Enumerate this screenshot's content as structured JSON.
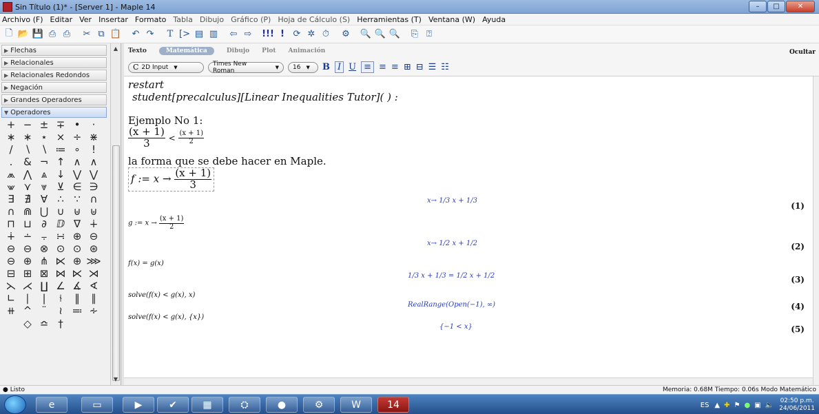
{
  "window": {
    "title": "Sin Título (1)* - [Server 1] - Maple 14",
    "minimize": "–",
    "maximize": "□",
    "close": "✕"
  },
  "menu": [
    "Archivo (F)",
    "Editar",
    "Ver",
    "Insertar",
    "Formato",
    "Tabla",
    "Dibujo",
    "Gráfico (P)",
    "Hoja de Cálculo (S)",
    "Herramientas (T)",
    "Ventana (W)",
    "Ayuda"
  ],
  "palette": {
    "sections": [
      "Flechas",
      "Relacionales",
      "Relacionales Redondos",
      "Negación",
      "Grandes Operadores"
    ],
    "open_section": "Operadores",
    "symbols": [
      "+",
      "−",
      "±",
      "∓",
      "•",
      "·",
      "∗",
      "∗",
      "⋆",
      "×",
      "÷",
      "⋇",
      "/",
      "∖",
      "∖",
      "≔",
      "∘",
      "!",
      ".",
      "&",
      "¬",
      "↑",
      "∧",
      "∧",
      "⩕",
      "⋀",
      "⩓",
      "↓",
      "⋁",
      "⋁",
      "⩖",
      "⋎",
      "⩔",
      "⊻",
      "∈",
      "∋",
      "∃",
      "∄",
      "∀",
      "∴",
      "∵",
      "∩",
      "∩",
      "⋒",
      "⋃",
      "∪",
      "⊎",
      "⊎",
      "⊓",
      "⊔",
      "∂",
      "ⅅ",
      "∇",
      "∔",
      "∔",
      "∸",
      "⨪",
      "∺",
      "⊕",
      "⊖",
      "⊖",
      "⊖",
      "⊗",
      "⊙",
      "⊙",
      "⊛",
      "⊖",
      "⊕",
      "⋔",
      "⋉",
      "⊕",
      "⋙",
      "⊟",
      "⊞",
      "⊠",
      "⋈",
      "⋉",
      "⋊",
      "⋋",
      "⋌",
      "∐",
      "∠",
      "∡",
      "∢",
      "∟",
      "∣",
      "|",
      "⫮",
      "‖",
      "∥",
      "⧺",
      "^",
      "¨",
      "≀",
      "≕",
      "∻"
    ],
    "last_row": [
      "◇",
      "≏",
      "†"
    ]
  },
  "context": {
    "tabs": [
      "Texto",
      "Matemática",
      "Dibujo",
      "Plot",
      "Animación"
    ],
    "active_tab": "Matemática",
    "hide": "Ocultar",
    "input_mode": "2D Input",
    "font": "Times New Roman",
    "size": "16"
  },
  "doc": {
    "cmd1": "restart",
    "cmd2": "student[precalculus][Linear Inequalities Tutor]( ) :",
    "heading": "Ejemplo No 1:",
    "ineq_num_left": "(x + 1)",
    "ineq_den_left": "3",
    "ineq_op": "<",
    "ineq_num_right": "(x + 1)",
    "ineq_den_right": "2",
    "note": "la forma que se debe hacer en Maple.",
    "f_prefix": "f := x →",
    "f_num": "(x + 1)",
    "f_den": "3",
    "g_prefix": "g := x →",
    "g_num": "(x + 1)",
    "g_den": "2",
    "cmd_eq": "f(x) = g(x)",
    "cmd_solve1": "solve(f(x) < g(x), x)",
    "cmd_solve2": "solve(f(x) < g(x), {x})",
    "out1": "x→ 1/3 x + 1/3",
    "out2": "x→ 1/2 x + 1/2",
    "out3": "1/3 x + 1/3 = 1/2 x + 1/2",
    "out4": "RealRange(Open(−1), ∞)",
    "out5": "{−1 < x}",
    "labels": [
      "(1)",
      "(2)",
      "(3)",
      "(4)",
      "(5)"
    ]
  },
  "status": {
    "left": "● Listo",
    "right": "Memoria: 0.68M  Tiempo: 0.06s  Modo Matemático"
  },
  "taskbar": {
    "lang": "ES",
    "time": "02:50 p.m.",
    "date": "24/06/2011"
  }
}
